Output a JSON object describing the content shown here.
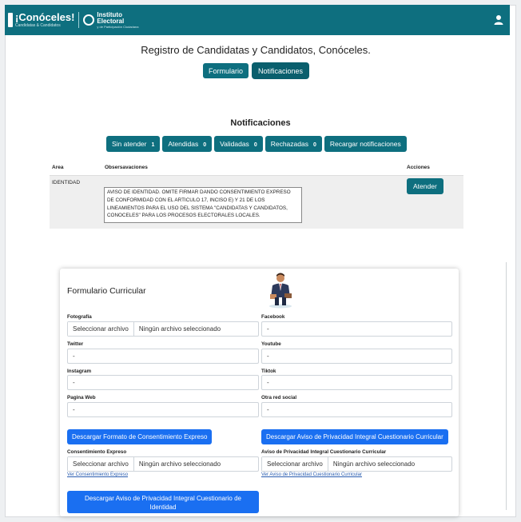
{
  "navbar": {
    "brand": "¡Conóceles!",
    "brand_sub": "Candidatas & Candidatos",
    "institute_line1": "Instituto",
    "institute_line2": "Electoral",
    "institute_sub": "y de Participación Ciudadana",
    "accent": "#0e6f7f"
  },
  "page": {
    "title": "Registro de Candidatas y Candidatos, Conóceles.",
    "tabs": [
      {
        "label": "Formulario"
      },
      {
        "label": "Notificaciones"
      }
    ]
  },
  "notifications": {
    "title": "Notificaciones",
    "filters": [
      {
        "label": "Sin atender",
        "count": "1"
      },
      {
        "label": "Atendidas",
        "count": "0"
      },
      {
        "label": "Validadas",
        "count": "0"
      },
      {
        "label": "Rechazadas",
        "count": "0"
      }
    ],
    "reload_label": "Recargar notificaciones",
    "columns": {
      "area": "Area",
      "observations": "Obsersavaciones",
      "actions": "Acciones"
    },
    "rows": [
      {
        "area": "IDENTIDAD",
        "observation": "AVISO DE IDENTIDAD. OMITE FIRMAR DANDO CONSENTIMIENTO EXPRESO DE CONFORMIDAD CON EL ARTICULO 17, INCISO E) Y 21 DE LOS LINEAMIENTOS PARA EL USO DEL SISTEMA \"CANDIDATAS Y CANDIDATOS, CONOCELES\" PARA LOS PROCESOS ELECTORALES LOCALES.",
        "action": "Atender"
      }
    ]
  },
  "form": {
    "title": "Formulario Curricular",
    "fields": {
      "photo": {
        "label": "Fotografía",
        "button": "Seleccionar archivo",
        "file": "Ningún archivo seleccionado"
      },
      "facebook": {
        "label": "Facebook",
        "value": "-"
      },
      "twitter": {
        "label": "Twitter",
        "value": "-"
      },
      "youtube": {
        "label": "Youtube",
        "value": "-"
      },
      "instagram": {
        "label": "Instagram",
        "value": "-"
      },
      "tiktok": {
        "label": "Tiktok",
        "value": "-"
      },
      "web": {
        "label": "Pagina Web",
        "value": "-"
      },
      "other": {
        "label": "Otra red social",
        "value": "-"
      }
    },
    "download_consent": "Descargar Formato de Consentimiento Expreso",
    "download_privacy": "Descargar Aviso de Privacidad Integral Cuestionario Curricular",
    "consent": {
      "label": "Consentimiento Expreso",
      "button": "Seleccionar archivo",
      "file": "Ningún archivo seleccionado",
      "link": "Ver Consentimiento Expreso"
    },
    "privacy": {
      "label": "Aviso de Privacidad Integral Cuestionario Curricular",
      "button": "Seleccionar archivo",
      "file": "Ningún archivo seleccionado",
      "link": "Ver Aviso de Privacidad Cuestionario Curricular"
    },
    "download_identity": "Descargar Aviso de Privacidad Integral Cuestionario de Identidad"
  }
}
